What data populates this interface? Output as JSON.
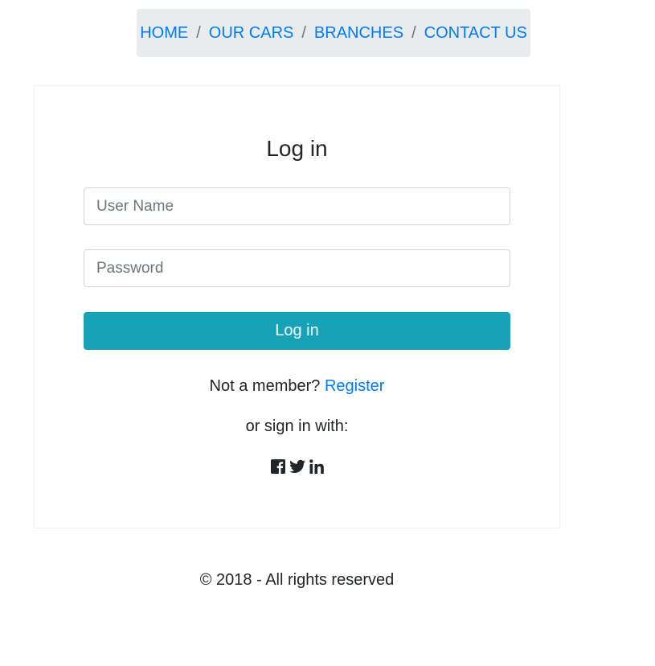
{
  "nav": {
    "items": [
      {
        "label": "HOME"
      },
      {
        "label": "OUR CARS"
      },
      {
        "label": "BRANCHES"
      },
      {
        "label": "CONTACT US"
      }
    ],
    "separator": "/"
  },
  "login": {
    "title": "Log in",
    "username_placeholder": "User Name",
    "password_placeholder": "Password",
    "submit_label": "Log in",
    "not_member_text": "Not a member?",
    "register_label": "Register",
    "or_sign_in_text": "or sign in with:",
    "social_icons": [
      "facebook-icon",
      "twitter-icon",
      "linkedin-icon"
    ]
  },
  "footer": {
    "text": "© 2018 - All rights reserved"
  },
  "colors": {
    "link": "#007bff",
    "button": "#17a2b8",
    "breadcrumb_bg": "#e9ecef"
  }
}
